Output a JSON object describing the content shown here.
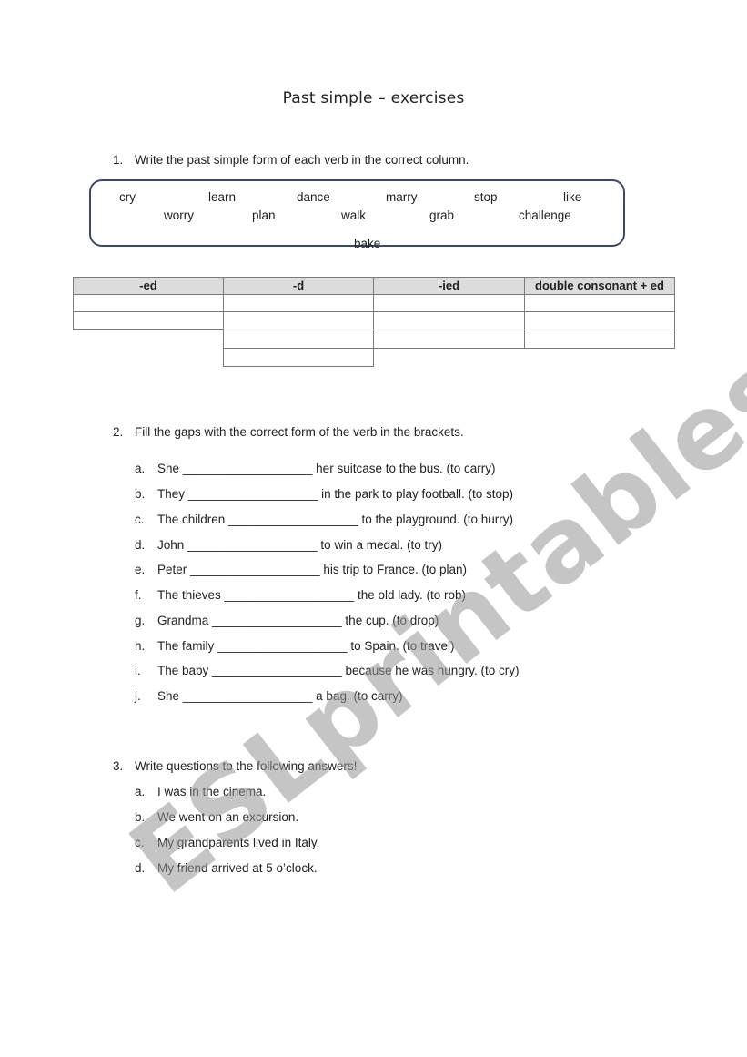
{
  "title": "Past simple – exercises",
  "exercise1": {
    "number": "1.",
    "instruction": "Write the past simple form of each verb in the correct column.",
    "verbs_row1": [
      "cry",
      "learn",
      "dance",
      "marry",
      "stop",
      "like"
    ],
    "verbs_row2": [
      "worry",
      "plan",
      "walk",
      "grab",
      "challenge"
    ],
    "verbs_row3": [
      "bake"
    ],
    "table": {
      "headers": [
        "-ed",
        "-d",
        "-ied",
        "double consonant + ed"
      ],
      "blank_rows_per_column": [
        2,
        4,
        3,
        3
      ]
    }
  },
  "exercise2": {
    "number": "2.",
    "instruction": "Fill the gaps with the correct form of the verb in the brackets.",
    "items": [
      {
        "letter": "a.",
        "text": "She ___________________ her suitcase to the bus. (to carry)"
      },
      {
        "letter": "b.",
        "text": "They ___________________ in the park to play football. (to stop)"
      },
      {
        "letter": "c.",
        "text": "The children ___________________ to the playground. (to hurry)"
      },
      {
        "letter": "d.",
        "text": "John ___________________ to win a medal. (to try)"
      },
      {
        "letter": "e.",
        "text": "Peter ___________________ his trip to France. (to plan)"
      },
      {
        "letter": "f.",
        "text": "The thieves ___________________ the old lady. (to rob)"
      },
      {
        "letter": "g.",
        "text": "Grandma ___________________ the cup. (to drop)"
      },
      {
        "letter": "h.",
        "text": "The family ___________________ to Spain. (to travel)"
      },
      {
        "letter": "i.",
        "text": "The baby ___________________ because he was hungry. (to cry)"
      },
      {
        "letter": "j.",
        "text": "She ___________________ a bag. (to carry)"
      }
    ]
  },
  "exercise3": {
    "number": "3.",
    "instruction": "Write questions to the following answers!",
    "items": [
      {
        "letter": "a.",
        "text": "I was in the cinema."
      },
      {
        "letter": "b.",
        "text": "We went on an excursion."
      },
      {
        "letter": "c.",
        "text": "My grandparents lived in Italy."
      },
      {
        "letter": "d.",
        "text": "My friend arrived at 5 o’clock."
      }
    ]
  },
  "watermark": "ESLprintables.com"
}
